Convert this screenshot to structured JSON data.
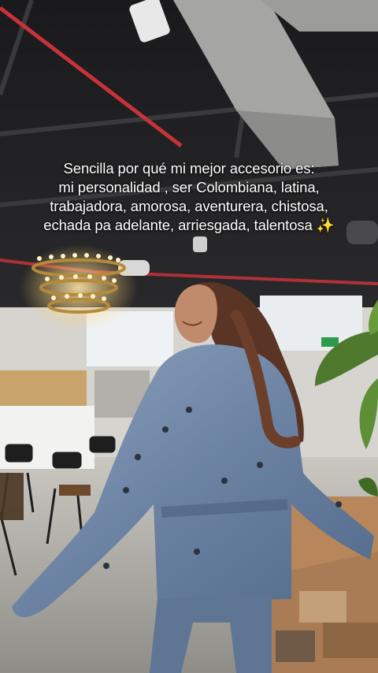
{
  "caption": {
    "line1": "Sencilla por qué mi mejor accesorio es:",
    "line2": "mi personalidad , ser Colombiana, latina,",
    "line3": "trabajadora, amorosa, aventurera, chistosa,",
    "line4": "echada pa adelante, arriesgada, talentosa",
    "emoji": "✨"
  },
  "colors": {
    "ceiling": "#1f1f21",
    "red_pipe": "#c8323a",
    "duct": "#9a9a98",
    "floor": "#b9b7b0",
    "jacket": "#6f86a6",
    "hair": "#5a3424",
    "plant": "#4f7a2e"
  },
  "icons": [
    "sparkles-icon"
  ]
}
